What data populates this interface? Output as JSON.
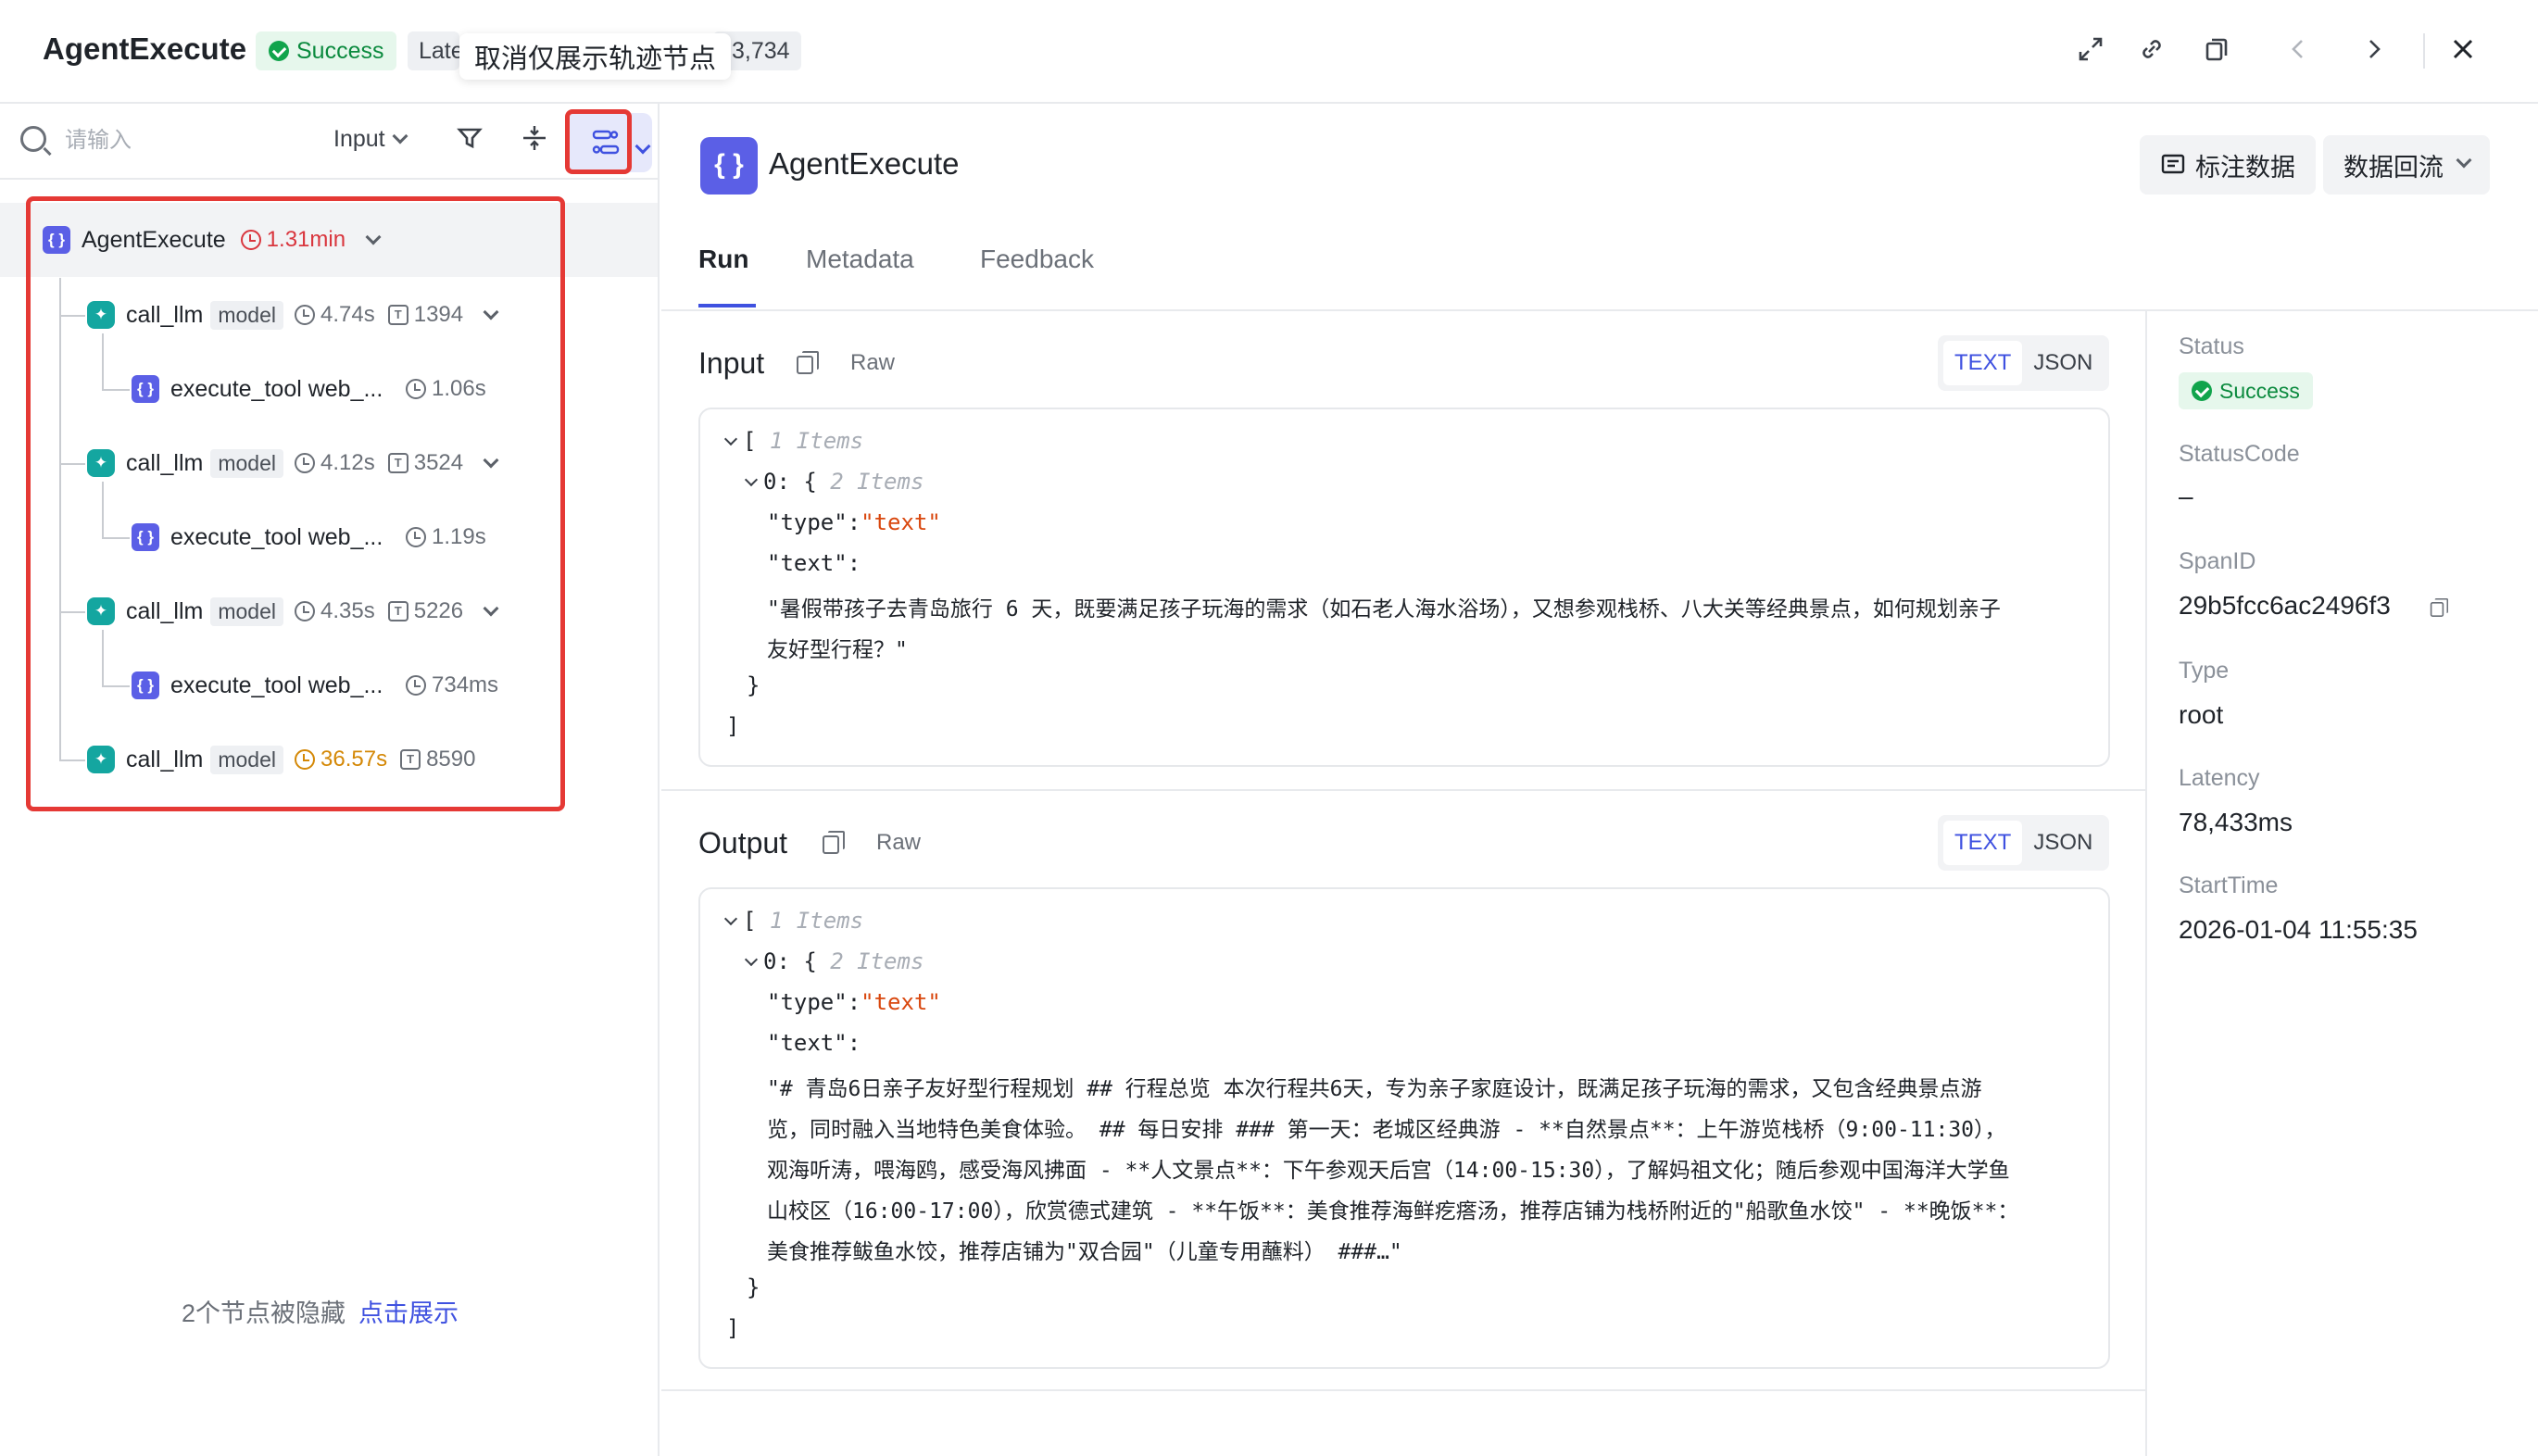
{
  "header": {
    "title": "AgentExecute",
    "status": "Success",
    "latency_chip_prefix": "Late",
    "latency_chip_suffix": "3,734",
    "tooltip": "取消仅展示轨迹节点"
  },
  "search": {
    "placeholder": "请输入",
    "select_label": "Input"
  },
  "tree": {
    "root": {
      "name": "AgentExecute",
      "duration": "1.31min"
    },
    "nodes": [
      {
        "name": "call_llm",
        "tag": "model",
        "duration": "4.74s",
        "tokens": "1394"
      },
      {
        "name": "execute_tool web_...",
        "duration": "1.06s"
      },
      {
        "name": "call_llm",
        "tag": "model",
        "duration": "4.12s",
        "tokens": "3524"
      },
      {
        "name": "execute_tool web_...",
        "duration": "1.19s"
      },
      {
        "name": "call_llm",
        "tag": "model",
        "duration": "4.35s",
        "tokens": "5226"
      },
      {
        "name": "execute_tool web_...",
        "duration": "734ms"
      },
      {
        "name": "call_llm",
        "tag": "model",
        "duration": "36.57s",
        "tokens": "8590"
      }
    ],
    "hidden_text": "2个节点被隐藏",
    "show_link": "点击展示"
  },
  "main": {
    "icon_label": "{ }",
    "title": "AgentExecute",
    "annotate_button": "标注数据",
    "backflow_button": "数据回流",
    "tabs": [
      "Run",
      "Metadata",
      "Feedback"
    ]
  },
  "input": {
    "title": "Input",
    "raw": "Raw",
    "toggle_text": "TEXT",
    "toggle_json": "JSON",
    "items_outer": "1 Items",
    "items_inner": "2 Items",
    "type_key": "\"type\":",
    "type_val": "\"text\"",
    "text_key": "\"text\":",
    "text_line1": "\"暑假带孩子去青岛旅行 6 天，既要满足孩子玩海的需求（如石老人海水浴场），又想参观栈桥、八大关等经典景点，如何规划亲子",
    "text_line2": "友好型行程？\""
  },
  "output": {
    "title": "Output",
    "raw": "Raw",
    "toggle_text": "TEXT",
    "toggle_json": "JSON",
    "items_outer": "1 Items",
    "items_inner": "2 Items",
    "type_key": "\"type\":",
    "type_val": "\"text\"",
    "text_key": "\"text\":",
    "text_line1": "\"# 青岛6日亲子友好型行程规划 ## 行程总览 本次行程共6天，专为亲子家庭设计，既满足孩子玩海的需求，又包含经典景点游",
    "text_line2": "览，同时融入当地特色美食体验。 ## 每日安排 ### 第一天：老城区经典游 - **自然景点**：上午游览栈桥（9:00-11:30），",
    "text_line3": "观海听涛，喂海鸥，感受海风拂面 - **人文景点**：下午参观天后宫（14:00-15:30），了解妈祖文化；随后参观中国海洋大学鱼",
    "text_line4": "山校区（16:00-17:00），欣赏德式建筑 - **午饭**：美食推荐海鲜疙瘩汤，推荐店铺为栈桥附近的\"船歌鱼水饺\" - **晚饭**：",
    "text_line5": "美食推荐鲅鱼水饺，推荐店铺为\"双合园\"（儿童专用蘸料） ###…\""
  },
  "details": {
    "status_label": "Status",
    "status_value": "Success",
    "statuscode_label": "StatusCode",
    "statuscode_value": "–",
    "spanid_label": "SpanID",
    "spanid_value": "29b5fcc6ac2496f3",
    "type_label": "Type",
    "type_value": "root",
    "latency_label": "Latency",
    "latency_value": "78,433ms",
    "starttime_label": "StartTime",
    "starttime_value": "2026-01-04 11:55:35"
  },
  "colors": {
    "accent": "#3f51e0",
    "success": "#11a44c",
    "highlight": "#e53935",
    "string": "#d9480f"
  }
}
